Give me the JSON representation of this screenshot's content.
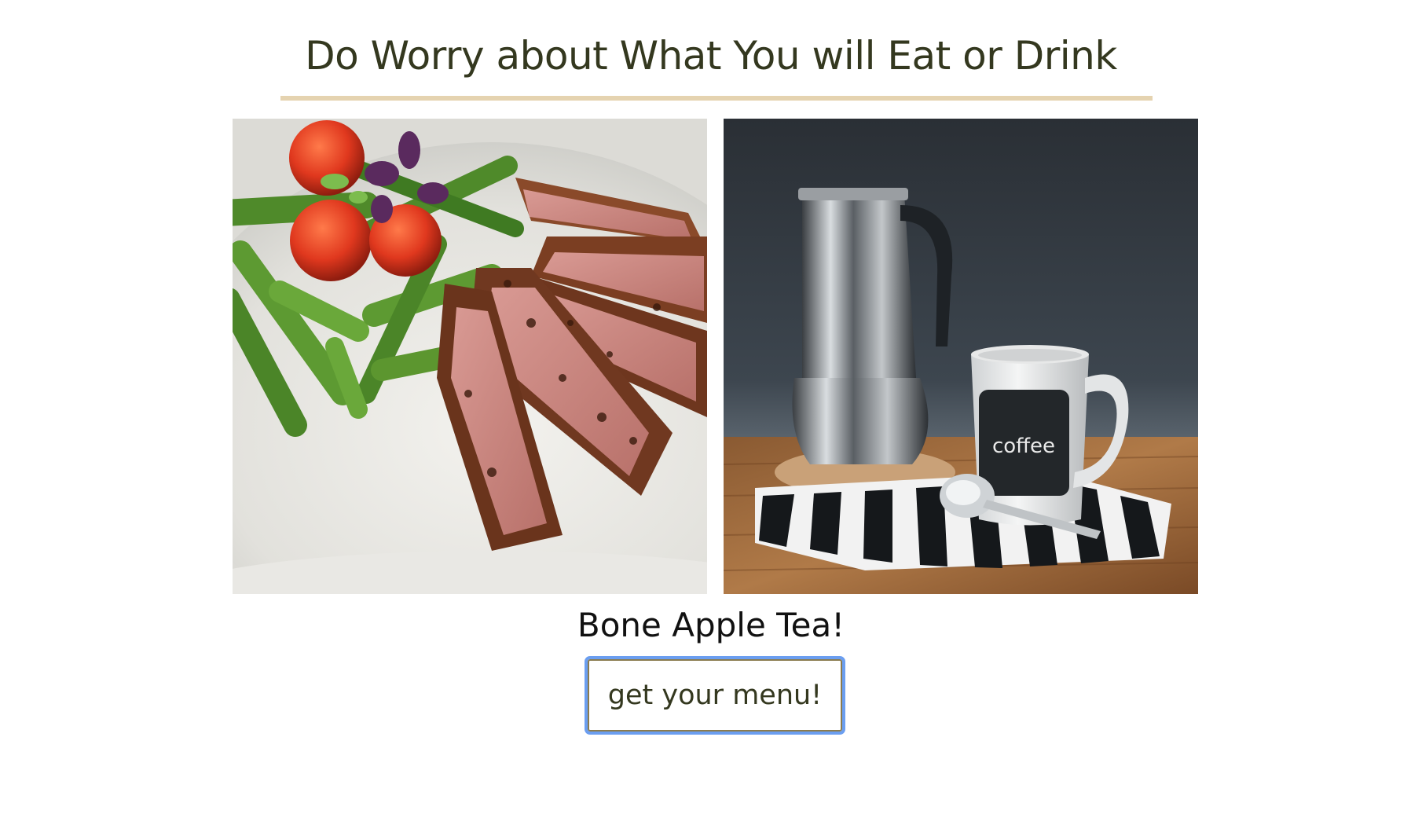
{
  "header": {
    "title": "Do Worry about What You will Eat or Drink"
  },
  "gallery": {
    "items": [
      {
        "icon": "steak-asparagus-photo"
      },
      {
        "icon": "coffee-pot-mug-photo",
        "mug_text": "coffee"
      }
    ]
  },
  "tagline": "Bone Apple Tea!",
  "cta": {
    "label": "get your menu!"
  },
  "colors": {
    "title": "#34381f",
    "rule": "#e5d3b0",
    "button_border": "#8a7b4e",
    "focus_ring": "#6b9ef0"
  }
}
